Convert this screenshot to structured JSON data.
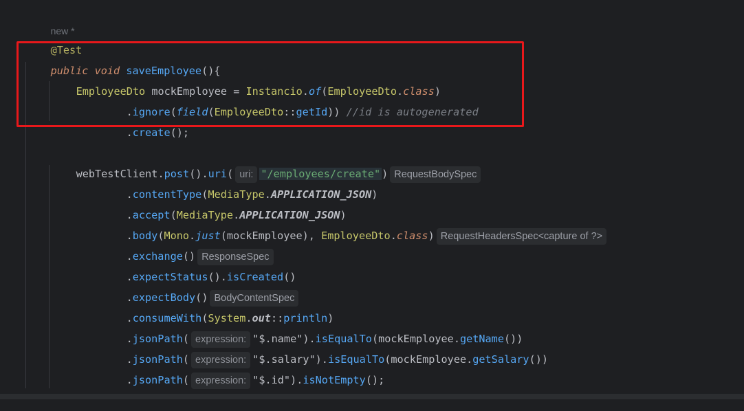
{
  "usage": "new *",
  "annotation": "@Test",
  "method": {
    "modifier": "public",
    "ret": "void",
    "name": "saveEmployee",
    "tail": "(){"
  },
  "line_mock": {
    "type": "EmployeeDto",
    "var": " mockEmployee ",
    "eq": "= ",
    "cls": "Instancio",
    ".": ".",
    "method": "of",
    "open": "(",
    "arg": "EmployeeDto",
    ".2": ".",
    "klass": "class",
    "close": ")"
  },
  "line_ignore": {
    "dot": ".",
    "method": "ignore",
    "open": "(",
    "fn": "field",
    "open2": "(",
    "cls": "EmployeeDto",
    "sep": "::",
    "ref": "getId",
    "close": "))",
    "comment": "//id is autogenerated"
  },
  "line_create": {
    "dot": ".",
    "method": "create",
    "tail": "();"
  },
  "line_client": {
    "var": "webTestClient",
    "dot": ".",
    "post": "post",
    "mid": "().",
    "uri": "uri",
    "open": "(",
    "hint": "uri:",
    "str": "\"/employees/create\"",
    "close": ")",
    "ret": "RequestBodySpec"
  },
  "line_ct": {
    "dot": ".",
    "method": "contentType",
    "open": "(",
    "cls": "MediaType",
    "dot2": ".",
    "const": "APPLICATION_JSON",
    "close": ")"
  },
  "line_accept": {
    "dot": ".",
    "method": "accept",
    "open": "(",
    "cls": "MediaType",
    "dot2": ".",
    "const": "APPLICATION_JSON",
    "close": ")"
  },
  "line_body": {
    "dot": ".",
    "method": "body",
    "open": "(",
    "cls": "Mono",
    "dot2": ".",
    "smeth": "just",
    "arg": "(mockEmployee), ",
    "cls2": "EmployeeDto",
    "dot3": ".",
    "klass": "class",
    "close": ")",
    "ret": "RequestHeadersSpec<capture of ?>"
  },
  "line_exchange": {
    "dot": ".",
    "method": "exchange",
    "tail": "()",
    "ret": "ResponseSpec"
  },
  "line_status": {
    "dot": ".",
    "method": "expectStatus",
    "mid": "().",
    "method2": "isCreated",
    "tail": "()"
  },
  "line_expbody": {
    "dot": ".",
    "method": "expectBody",
    "tail": "()",
    "ret": "BodyContentSpec"
  },
  "line_consume": {
    "dot": ".",
    "method": "consumeWith",
    "open": "(",
    "cls": "System",
    "dot2": ".",
    "static": "out",
    "sep": "::",
    "ref": "println",
    "close": ")"
  },
  "line_json1": {
    "dot": ".",
    "method": "jsonPath",
    "open": "(",
    "hint": "expression:",
    "str": "\"$.name\"",
    "mid": ").",
    "m2": "isEqualTo",
    "open2": "(mockEmployee.",
    "m3": "getName",
    "close": "())"
  },
  "line_json2": {
    "dot": ".",
    "method": "jsonPath",
    "open": "(",
    "hint": "expression:",
    "str": "\"$.salary\"",
    "mid": ").",
    "m2": "isEqualTo",
    "open2": "(mockEmployee.",
    "m3": "getSalary",
    "close": "())"
  },
  "line_json3": {
    "dot": ".",
    "method": "jsonPath",
    "open": "(",
    "hint": "expression:",
    "str": "\"$.id\"",
    "mid": ").",
    "m2": "isNotEmpty",
    "close": "();"
  },
  "colors": {
    "background": "#1e1f22",
    "keyword": "#cf8e6d",
    "method": "#56a8f5",
    "class": "#c7c76a",
    "string": "#6aab73",
    "comment": "#7a7e85",
    "highlight": "#e8181b"
  }
}
